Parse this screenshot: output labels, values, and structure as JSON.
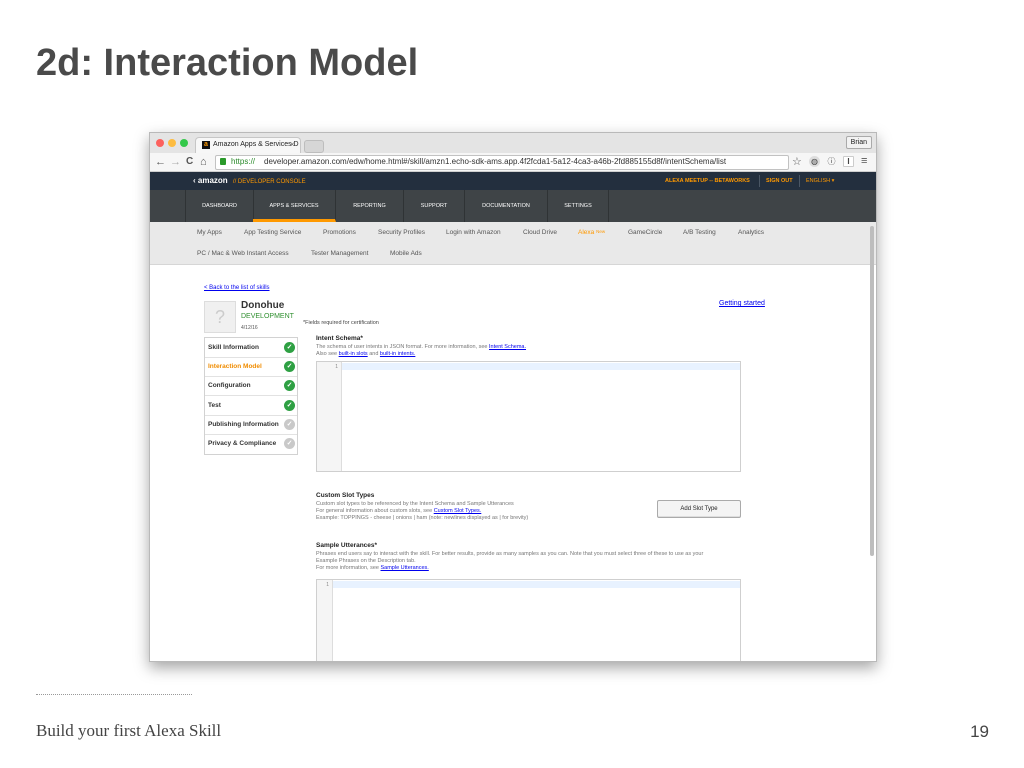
{
  "slide": {
    "title": "2d: Interaction Model",
    "footer": "Build your first Alexa Skill",
    "page_number": "19"
  },
  "browser": {
    "tab_title": "Amazon Apps & Services D",
    "tab_favicon": "a",
    "tab_close": "×",
    "profile": "Brian",
    "url_scheme": "https://",
    "url_host_path": "developer.amazon.com/edw/home.html#/skill/amzn1.echo-sdk-ams.app.4f2fcda1-5a12-4ca3-a46b-2fd885155d8f/intentSchema/list",
    "icons": {
      "back": "←",
      "forward": "→",
      "reload": "C",
      "home": "⌂",
      "star": "☆",
      "ext1": "◍",
      "ext2": "ⓘ",
      "ext3": "I",
      "menu": "≡"
    }
  },
  "site": {
    "logo_amazon": "‹ amazon",
    "logo_console": "// DEVELOPER CONSOLE",
    "top_right": {
      "meetup": "ALEXA MEETUP -- BETAWORKS",
      "sign_out": "SIGN OUT",
      "language": "ENGLISH ▾"
    },
    "main_nav": [
      "DASHBOARD",
      "APPS & SERVICES",
      "REPORTING",
      "SUPPORT",
      "DOCUMENTATION",
      "SETTINGS"
    ],
    "sub_nav_row1": [
      "My Apps",
      "App Testing Service",
      "Promotions",
      "Security Profiles",
      "Login with Amazon",
      "Cloud Drive",
      "Alexa",
      "GameCircle",
      "A/B Testing",
      "Analytics"
    ],
    "alexa_badge": "New",
    "sub_nav_row2": [
      "PC / Mac & Web Instant Access",
      "Tester Management",
      "Mobile Ads"
    ]
  },
  "skill": {
    "back_link": "< Back to the list of skills",
    "thumb_glyph": "?",
    "name": "Donohue",
    "status": "DEVELOPMENT",
    "date": "4/12/16",
    "getting_started": "Getting started",
    "required_note": "*Fields required for certification",
    "menu": [
      {
        "label": "Skill Information",
        "state": "done"
      },
      {
        "label": "Interaction Model",
        "state": "done",
        "active": true
      },
      {
        "label": "Configuration",
        "state": "done"
      },
      {
        "label": "Test",
        "state": "done"
      },
      {
        "label": "Publishing Information",
        "state": "pending"
      },
      {
        "label": "Privacy & Compliance",
        "state": "pending"
      }
    ],
    "check_glyph": "✓"
  },
  "intent_schema": {
    "title": "Intent Schema*",
    "desc_line1_pre": "The schema of user intents in JSON format. For more information, see ",
    "desc_line1_link": "Intent Schema.",
    "desc_line2_pre": "Also see ",
    "desc_line2_link1": "built-in slots",
    "desc_line2_mid": " and ",
    "desc_line2_link2": "built-in intents.",
    "line_number": "1"
  },
  "custom_slots": {
    "title": "Custom Slot Types",
    "desc_line1": "Custom slot types to be referenced by the Intent Schema and Sample Utterances",
    "desc_line2_pre": "For general information about custom slots, see ",
    "desc_line2_link": "Custom Slot Types.",
    "desc_line3": "Example: TOPPINGS - cheese | onions | ham (note: newlines displayed as | for brevity)",
    "button": "Add Slot Type"
  },
  "sample_utterances": {
    "title": "Sample Utterances*",
    "desc_line1": "Phrases end users say to interact with the skill. For better results, provide as many samples as you can. Note that you must select three of these to use as your",
    "desc_line2": "Example Phrases on the Description tab.",
    "desc_line3_pre": "For more information, see ",
    "desc_line3_link": "Sample Utterances.",
    "line_number": "1"
  },
  "colors": {
    "accent": "#ff9900",
    "topbar": "#232f3e",
    "mainnav": "#3f4447",
    "check_done": "#2ea043",
    "check_pending": "#c9c9c9"
  }
}
